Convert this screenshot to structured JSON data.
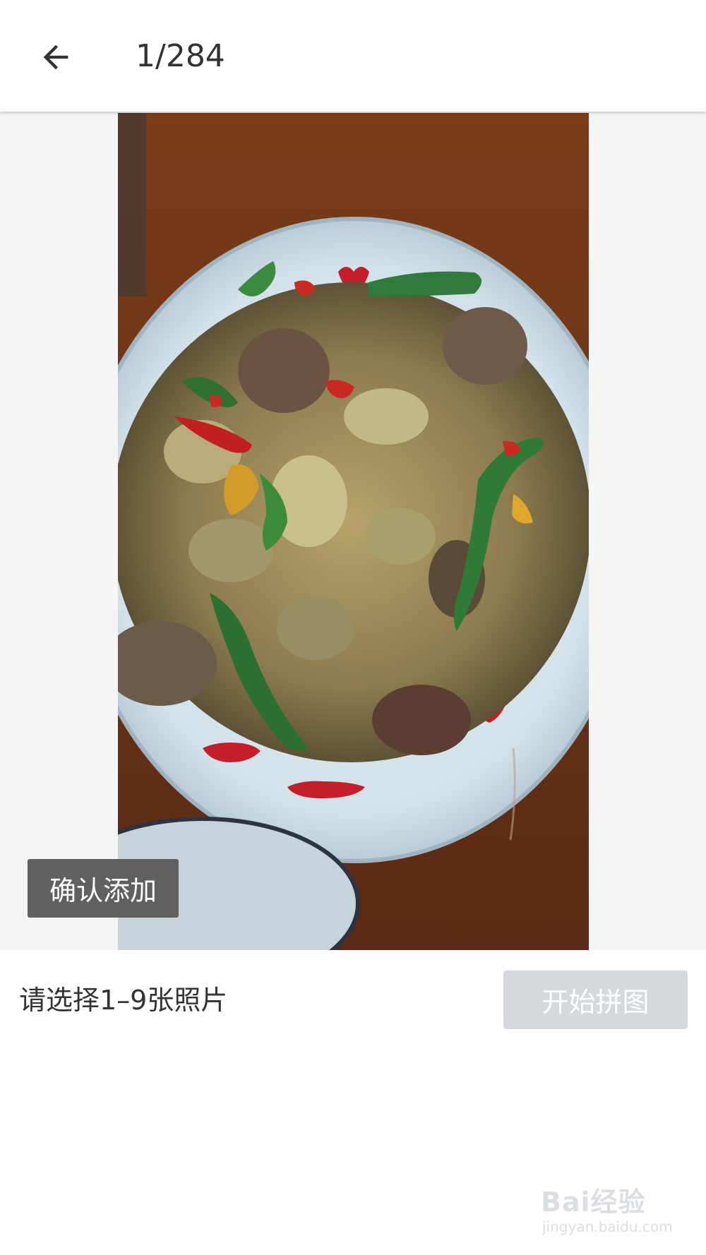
{
  "header": {
    "back_icon": "arrow-left-icon",
    "counter": "1/284"
  },
  "preview": {
    "photo_subject": "stir-fried-dish-photo",
    "confirm_label": "确认添加"
  },
  "footer": {
    "hint": "请选择1–9张照片",
    "start_label": "开始拼图"
  },
  "watermark": {
    "logo": "Bai经验",
    "url": "jingyan.baidu.com"
  },
  "colors": {
    "confirm_bg": "#606060",
    "start_bg": "#d5d9dd",
    "text": "#333333"
  }
}
